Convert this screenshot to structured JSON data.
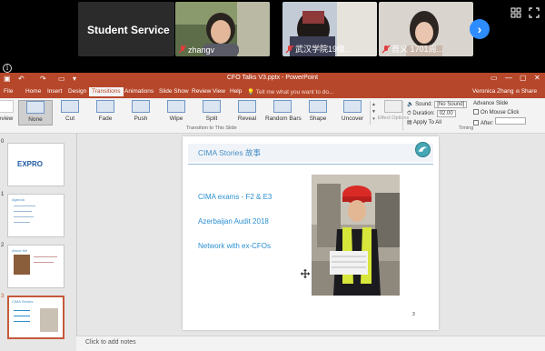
{
  "zoom": {
    "tiles": [
      {
        "big_label": "Student Service",
        "name": ""
      },
      {
        "name": "zhangv"
      },
      {
        "name": "武汉学院19级..."
      },
      {
        "name": "首义 1701周..."
      }
    ],
    "next_icon": "chevron-right"
  },
  "ppt": {
    "title": "CFO Talks V3.pptx - PowerPoint",
    "tabs": [
      "File",
      "Home",
      "Insert",
      "Design",
      "Transitions",
      "Animations",
      "Slide Show",
      "Review",
      "View",
      "Help"
    ],
    "active_tab": "Transitions",
    "tell_me": "Tell me what you want to do...",
    "user": "Veronica Zhang",
    "share": "Share",
    "ribbon": {
      "preview": "review",
      "transitions": [
        "None",
        "Cut",
        "Fade",
        "Push",
        "Wipe",
        "Split",
        "Reveal",
        "Random Bars",
        "Shape",
        "Uncover"
      ],
      "effect_options": "Effect Options",
      "group_transition": "Transition to This Slide",
      "sound_label": "Sound:",
      "sound_value": "[No Sound]",
      "duration_label": "Duration:",
      "duration_value": "02.00",
      "apply_all": "Apply To All",
      "advance_label": "Advance Slide",
      "on_mouse_click": "On Mouse Click",
      "after_label": "After:",
      "after_value": "",
      "group_timing": "Timing"
    },
    "thumbnails": [
      {
        "num": "0",
        "brand": "EXPRO",
        "title": ""
      },
      {
        "num": "1",
        "brand": "",
        "title": "Agenda"
      },
      {
        "num": "2",
        "brand": "",
        "title": "About Me"
      },
      {
        "num": "3",
        "brand": "",
        "title": "CIMA Stories"
      }
    ],
    "slide": {
      "title": "CIMA Stories 故事",
      "bullets": [
        "CIMA exams - F2 & E3",
        "Azerbaijan Audit 2018",
        "Network with ex-CFOs"
      ],
      "number": "3"
    },
    "notes": "Click to add notes"
  },
  "colors": {
    "accent": "#b7472a",
    "zoom_blue": "#2d8cff",
    "slide_text": "#2a8fcf"
  }
}
